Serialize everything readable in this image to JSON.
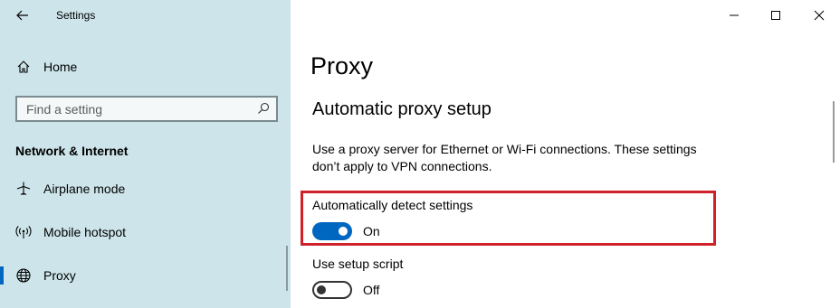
{
  "app": {
    "title": "Settings"
  },
  "sidebar": {
    "home_label": "Home",
    "search": {
      "placeholder": "Find a setting"
    },
    "section_header": "Network & Internet",
    "items": [
      {
        "label": "Airplane mode",
        "icon": "airplane-icon"
      },
      {
        "label": "Mobile hotspot",
        "icon": "mobile-hotspot-icon"
      },
      {
        "label": "Proxy",
        "icon": "globe-icon",
        "active": true
      }
    ]
  },
  "main": {
    "page_title": "Proxy",
    "section_title": "Automatic proxy setup",
    "description": "Use a proxy server for Ethernet or Wi-Fi connections. These settings don’t apply to VPN connections.",
    "settings": [
      {
        "label": "Automatically detect settings",
        "state": "On",
        "enabled": true,
        "highlighted": true
      },
      {
        "label": "Use setup script",
        "state": "Off",
        "enabled": false
      }
    ]
  },
  "colors": {
    "sidebar_bg": "#cde5ea",
    "accent": "#0067c0",
    "highlight_border": "#d0202a"
  }
}
